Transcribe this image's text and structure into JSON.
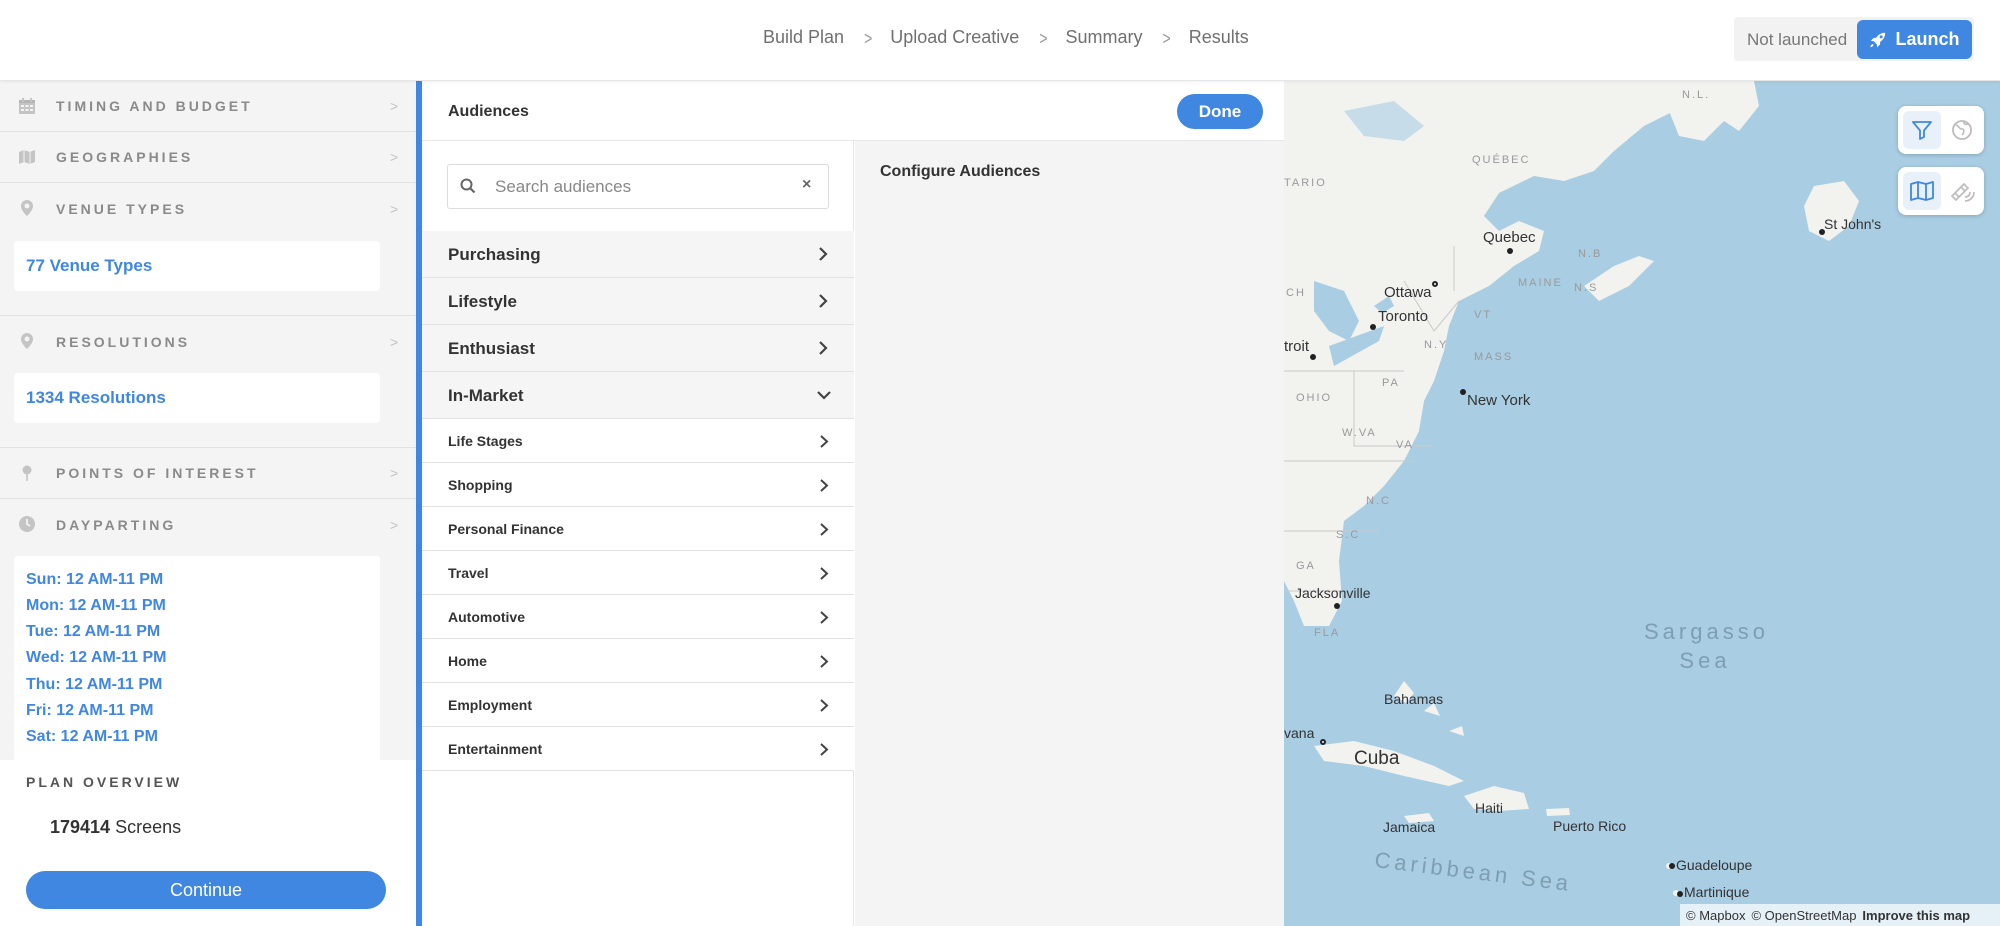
{
  "nav": {
    "steps": [
      "Build Plan",
      "Upload Creative",
      "Summary",
      "Results"
    ],
    "status": "Not launched",
    "launch_label": "Launch"
  },
  "sidebar": {
    "sections": {
      "timing": "TIMING AND BUDGET",
      "geographies": "GEOGRAPHIES",
      "venue_types": "VENUE TYPES",
      "resolutions": "RESOLUTIONS",
      "poi": "POINTS OF INTEREST",
      "dayparting": "DAYPARTING"
    },
    "venue_types_value": "77 Venue Types",
    "resolutions_value": "1334 Resolutions",
    "dayparting_values": [
      "Sun: 12 AM-11 PM",
      "Mon: 12 AM-11 PM",
      "Tue: 12 AM-11 PM",
      "Wed: 12 AM-11 PM",
      "Thu: 12 AM-11 PM",
      "Fri: 12 AM-11 PM",
      "Sat: 12 AM-11 PM"
    ]
  },
  "overview": {
    "title": "PLAN OVERVIEW",
    "screens_count": "179414",
    "screens_label": "Screens",
    "continue_label": "Continue"
  },
  "audiences": {
    "title": "Audiences",
    "done_label": "Done",
    "search_placeholder": "Search audiences",
    "clear_icon": "×",
    "categories": [
      "Purchasing",
      "Lifestyle",
      "Enthusiast",
      "In-Market"
    ],
    "in_market_items": [
      "Life Stages",
      "Shopping",
      "Personal Finance",
      "Travel",
      "Automotive",
      "Home",
      "Employment",
      "Entertainment"
    ],
    "config_title": "Configure Audiences"
  },
  "map": {
    "cities": {
      "st_johns": "St John's",
      "quebec": "Quebec",
      "ottawa": "Ottawa",
      "toronto": "Toronto",
      "detroit": "troit",
      "new_york": "New York",
      "jacksonville": "Jacksonville",
      "bahamas": "Bahamas",
      "havana": "vana",
      "cuba": "Cuba",
      "haiti": "Haiti",
      "jamaica": "Jamaica",
      "puerto_rico": "Puerto Rico",
      "guadeloupe": "Guadeloupe",
      "martinique": "Martinique"
    },
    "regions": {
      "nl": "N.L.",
      "quebec_prov": "QUÉBEC",
      "ontario": "TARIO",
      "nb": "N.B",
      "maine": "MAINE",
      "ns": "N.S",
      "vt": "VT",
      "ny": "N.Y",
      "mass": "MASS",
      "pa": "PA",
      "ohio": "OHIO",
      "wva": "W.VA",
      "va": "VA",
      "nc": "N.C",
      "sc": "S.C",
      "ga": "GA",
      "fla": "FLA",
      "mich": "CH"
    },
    "seas": {
      "sargasso_1": "Sargasso",
      "sargasso_2": "Sea",
      "caribbean": "Caribbean Sea"
    },
    "attribution": {
      "mapbox": "© Mapbox",
      "osm": "© OpenStreetMap",
      "improve": "Improve this map"
    },
    "colors": {
      "water": "#a9cde3",
      "land": "#f2f2ef",
      "accent": "#3f87e0"
    }
  }
}
